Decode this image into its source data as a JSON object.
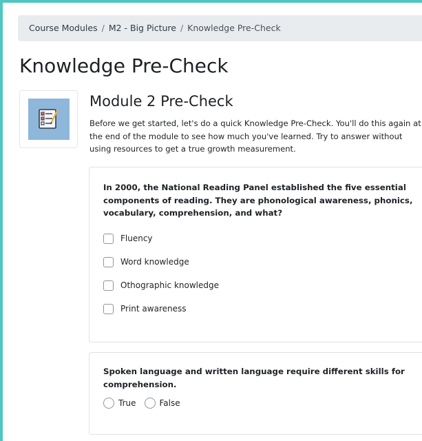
{
  "breadcrumb": {
    "items": [
      "Course Modules",
      "M2 - Big Picture"
    ],
    "current": "Knowledge Pre-Check",
    "separator": "/"
  },
  "page": {
    "title": "Knowledge Pre-Check"
  },
  "module": {
    "icon": "checklist-icon",
    "title": "Module 2 Pre-Check",
    "description": "Before we get started, let's do a quick Knowledge Pre-Check. You'll do this again at the end of the module to see how much you've learned. Try to answer without using resources to get a true growth measurement."
  },
  "questions": [
    {
      "text": "In 2000, the National Reading Panel established the five essential components of reading. They are phonological awareness, phonics, vocabulary, comprehension, and what?",
      "type": "checkbox",
      "options": [
        "Fluency",
        "Word knowledge",
        "Othographic knowledge",
        "Print awareness"
      ]
    },
    {
      "text": "Spoken language and written language require different skills for comprehension.",
      "type": "radio",
      "options": [
        "True",
        "False"
      ]
    }
  ],
  "colors": {
    "frame_border": "#4fc7c1",
    "breadcrumb_bg": "#e9ecef",
    "icon_tile": "#8fb7dc"
  }
}
